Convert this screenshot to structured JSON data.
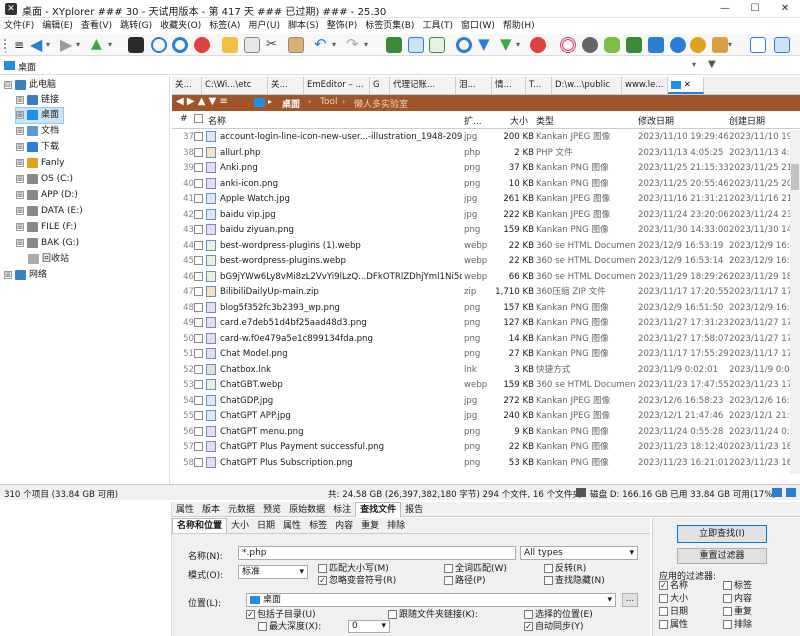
{
  "window": {
    "title": "桌面 - XYplorer ### 30 - 天试用版本 - 第 417 天 ### 已过期) ### - 25.30",
    "min": "—",
    "max": "☐",
    "close": "✕"
  },
  "menu": [
    "文件(F)",
    "编辑(E)",
    "查看(V)",
    "跳转(G)",
    "收藏夹(O)",
    "标签(A)",
    "用户(U)",
    "脚本(S)",
    "整饰(P)",
    "标签页集(B)",
    "工具(T)",
    "窗口(W)",
    "帮助(H)"
  ],
  "address": {
    "value": "桌面"
  },
  "tree": [
    {
      "label": "此电脑",
      "level": 0,
      "expander": "⊟",
      "color": "#3a7fc4"
    },
    {
      "label": "链接",
      "level": 1,
      "expander": "⊞",
      "color": "#3a7fc4"
    },
    {
      "label": "桌面",
      "level": 1,
      "expander": "⊞",
      "color": "#1e8fe6",
      "selected": true
    },
    {
      "label": "文档",
      "level": 1,
      "expander": "⊞",
      "color": "#5b9bd5"
    },
    {
      "label": "下载",
      "level": 1,
      "expander": "⊞",
      "color": "#2a7fd4"
    },
    {
      "label": "Fanly",
      "level": 1,
      "expander": "⊞",
      "color": "#e0a020"
    },
    {
      "label": "OS (C:)",
      "level": 1,
      "expander": "⊞",
      "color": "#888"
    },
    {
      "label": "APP (D:)",
      "level": 1,
      "expander": "⊞",
      "color": "#888"
    },
    {
      "label": "DATA (E:)",
      "level": 1,
      "expander": "⊞",
      "color": "#888"
    },
    {
      "label": "FILE (F:)",
      "level": 1,
      "expander": "⊞",
      "color": "#888"
    },
    {
      "label": "BAK (G:)",
      "level": 1,
      "expander": "⊞",
      "color": "#888"
    },
    {
      "label": "回收站",
      "level": 1,
      "expander": "",
      "color": "#aaa"
    },
    {
      "label": "网络",
      "level": 0,
      "expander": "⊞",
      "color": "#3a7fc4"
    }
  ],
  "tabs": [
    "关...",
    "C:\\Wi...\\etc",
    "关...",
    "EmEditor – ...",
    "G",
    "代理记账...",
    "泪...",
    "情...",
    "T...",
    "D:\\w...\\public",
    "www.le..."
  ],
  "breadcrumb": [
    "桌面",
    "Tool",
    "懒人多实验室"
  ],
  "columns": {
    "num": "#",
    "name": "名称",
    "ext": "扩...",
    "size": "大小",
    "type": "类型",
    "modified": "修改日期",
    "created": "创建日期"
  },
  "files": [
    {
      "n": "37",
      "name": "account-login-line-icon-new-user...-illustration_1948-2097.avif.jpg",
      "ext": "jpg",
      "size": "200 KB",
      "type": "Kankan JPEG 图像",
      "mod": "2023/11/10 19:29:46",
      "cre": "2023/11/10 19:29:46"
    },
    {
      "n": "38",
      "name": "allurl.php",
      "ext": "php",
      "size": "2 KB",
      "type": "PHP 文件",
      "mod": "2023/11/13 4:05:25",
      "cre": "2023/11/13 4:05:25"
    },
    {
      "n": "39",
      "name": "Anki.png",
      "ext": "png",
      "size": "37 KB",
      "type": "Kankan PNG 图像",
      "mod": "2023/11/25 21:15:33",
      "cre": "2023/11/25 21:15:33"
    },
    {
      "n": "40",
      "name": "anki-icon.png",
      "ext": "png",
      "size": "10 KB",
      "type": "Kankan PNG 图像",
      "mod": "2023/11/25 20:55:46",
      "cre": "2023/11/25 20:55:46"
    },
    {
      "n": "41",
      "name": "Apple Watch.jpg",
      "ext": "jpg",
      "size": "261 KB",
      "type": "Kankan JPEG 图像",
      "mod": "2023/11/16 21:31:21",
      "cre": "2023/11/16 21:31:21"
    },
    {
      "n": "42",
      "name": "baidu vip.jpg",
      "ext": "jpg",
      "size": "222 KB",
      "type": "Kankan JPEG 图像",
      "mod": "2023/11/24 23:20:06",
      "cre": "2023/11/24 23:20:06"
    },
    {
      "n": "43",
      "name": "baidu ziyuan.png",
      "ext": "png",
      "size": "159 KB",
      "type": "Kankan PNG 图像",
      "mod": "2023/11/30 14:33:00",
      "cre": "2023/11/30 14:33:00"
    },
    {
      "n": "44",
      "name": "best-wordpress-plugins (1).webp",
      "ext": "webp",
      "size": "22 KB",
      "type": "360 se HTML Document",
      "mod": "2023/12/9 16:53:19",
      "cre": "2023/12/9 16:53:19"
    },
    {
      "n": "45",
      "name": "best-wordpress-plugins.webp",
      "ext": "webp",
      "size": "22 KB",
      "type": "360 se HTML Document",
      "mod": "2023/12/9 16:53:14",
      "cre": "2023/12/9 16:53:14"
    },
    {
      "n": "46",
      "name": "bG9jYWw6Ly8vMi8zL2VvYi9lLzQ...DFkOTRlZDhjYml1Ni5qcGc.webp",
      "ext": "webp",
      "size": "66 KB",
      "type": "360 se HTML Document",
      "mod": "2023/11/29 18:29:26",
      "cre": "2023/11/29 18:29:26"
    },
    {
      "n": "47",
      "name": "BilibiliDailyUp-main.zip",
      "ext": "zip",
      "size": "1,710 KB",
      "type": "360压缩 ZIP 文件",
      "mod": "2023/11/17 17:20:55",
      "cre": "2023/11/17 17:20:55"
    },
    {
      "n": "48",
      "name": "blog5f352fc3b2393_wp.png",
      "ext": "png",
      "size": "157 KB",
      "type": "Kankan PNG 图像",
      "mod": "2023/12/9 16:51:50",
      "cre": "2023/12/9 16:51:50"
    },
    {
      "n": "49",
      "name": "card.e7deb51d4bf25aad48d3.png",
      "ext": "png",
      "size": "127 KB",
      "type": "Kankan PNG 图像",
      "mod": "2023/11/27 17:31:23",
      "cre": "2023/11/27 17:31:23"
    },
    {
      "n": "50",
      "name": "card-w.f0e479a5e1c899134fda.png",
      "ext": "png",
      "size": "14 KB",
      "type": "Kankan PNG 图像",
      "mod": "2023/11/27 17:58:07",
      "cre": "2023/11/27 17:58:07"
    },
    {
      "n": "51",
      "name": "Chat Model.png",
      "ext": "png",
      "size": "27 KB",
      "type": "Kankan PNG 图像",
      "mod": "2023/11/17 17:55:29",
      "cre": "2023/11/17 17:55:29"
    },
    {
      "n": "52",
      "name": "Chatbox.lnk",
      "ext": "lnk",
      "size": "3 KB",
      "type": "快捷方式",
      "mod": "2023/11/9 0:02:01",
      "cre": "2023/11/9 0:02:01"
    },
    {
      "n": "53",
      "name": "ChatGBT.webp",
      "ext": "webp",
      "size": "159 KB",
      "type": "360 se HTML Document",
      "mod": "2023/11/23 17:47:55",
      "cre": "2023/11/23 17:47:55"
    },
    {
      "n": "54",
      "name": "ChatGDP.jpg",
      "ext": "jpg",
      "size": "272 KB",
      "type": "Kankan JPEG 图像",
      "mod": "2023/12/6 16:58:23",
      "cre": "2023/12/6 16:58:23"
    },
    {
      "n": "55",
      "name": "ChatGPT APP.jpg",
      "ext": "jpg",
      "size": "240 KB",
      "type": "Kankan JPEG 图像",
      "mod": "2023/12/1 21:47:46",
      "cre": "2023/12/1 21:47:46"
    },
    {
      "n": "56",
      "name": "ChatGPT menu.png",
      "ext": "png",
      "size": "9 KB",
      "type": "Kankan PNG 图像",
      "mod": "2023/11/24 0:55:28",
      "cre": "2023/11/24 0:55:28"
    },
    {
      "n": "57",
      "name": "ChatGPT Plus Payment successful.png",
      "ext": "png",
      "size": "22 KB",
      "type": "Kankan PNG 图像",
      "mod": "2023/11/23 18:12:40",
      "cre": "2023/11/23 18:12:40"
    },
    {
      "n": "58",
      "name": "ChatGPT Plus Subscription.png",
      "ext": "png",
      "size": "53 KB",
      "type": "Kankan PNG 图像",
      "mod": "2023/11/23 16:21:01",
      "cre": "2023/11/23 16:21:01"
    }
  ],
  "status": {
    "items": "310 个项目 (33.84 GB 可用)",
    "total": "共: 24.58 GB (26,397,382,180 字节)  294 个文件, 16 个文件夹",
    "disk": "磁盘 D: 166.16 GB 已用   33.84 GB 可用(17%)"
  },
  "infotabs": [
    "属性",
    "版本",
    "元数据",
    "预览",
    "原始数据",
    "标注",
    "查找文件",
    "报告"
  ],
  "findtabs": [
    "名称和位置",
    "大小",
    "日期",
    "属性",
    "标签",
    "内容",
    "重复",
    "排除"
  ],
  "find": {
    "name_label": "名称(N):",
    "name_value": "*.php",
    "types": "All types",
    "mode_label": "模式(O):",
    "mode_value": "标准",
    "opt_case": "匹配大小写(M)",
    "opt_whole": "全词匹配(W)",
    "opt_invert": "反转(R)",
    "opt_diacritic": "忽略变音符号(R)",
    "opt_path": "路径(P)",
    "opt_hidden": "查找隐藏(N)",
    "loc_label": "位置(L):",
    "loc_value": "桌面",
    "browse": "...",
    "opt_sub": "包括子目录(U)",
    "opt_follow": "跟随文件夹链接(K):",
    "opt_selloc": "选择的位置(E)",
    "opt_depth": "最大深度(X):",
    "depth_value": "0",
    "opt_sync": "自动同步(Y)",
    "btn_find": "立即查找(I)",
    "btn_reset": "重置过滤器",
    "applied_label": "应用的过滤器:",
    "filters": [
      {
        "label": "名称",
        "on": true
      },
      {
        "label": "标签",
        "on": false
      },
      {
        "label": "大小",
        "on": false
      },
      {
        "label": "内容",
        "on": false
      },
      {
        "label": "日期",
        "on": false
      },
      {
        "label": "重复",
        "on": false
      },
      {
        "label": "属性",
        "on": false
      },
      {
        "label": "排除",
        "on": false
      }
    ]
  }
}
